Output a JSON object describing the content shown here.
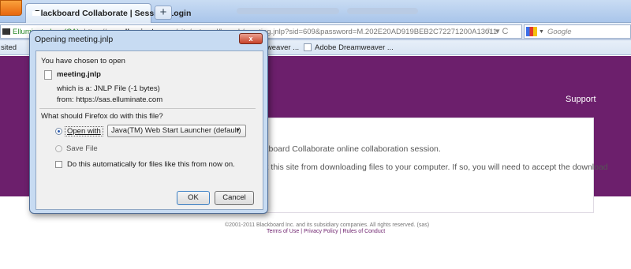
{
  "browser": {
    "tab_title": "Blackboard Collaborate | Session Login",
    "new_tab_glyph": "+",
    "url": {
      "site_identity": "Elluminate Inc. (CA)",
      "scheme": "https://",
      "host": "sas.elluminate.com",
      "rest": "/site/external/launch/meeting.jnlp?sid=609&password=M.202E20AD919BEB2C72271200A13011"
    },
    "search_placeholder": "Google",
    "bookmarks": {
      "partial_left": "sited",
      "item1": "mweaver ...",
      "item2": "Adobe Dreamweaver ..."
    }
  },
  "page": {
    "support_link": "Support",
    "line1": "ckboard Collaborate online collaboration session.",
    "line2": "ck this site from downloading files to your computer. If so, you will need to accept the download",
    "footer_copyright": "©2001-2011 Blackboard Inc. and its subsidiary companies. All rights reserved. (sas)",
    "footer_links": [
      "Terms of Use",
      "Privacy Policy",
      "Rules of Conduct"
    ],
    "footer_separator": "|"
  },
  "dialog": {
    "title": "Opening meeting.jnlp",
    "close_label": "x",
    "intro": "You have chosen to open",
    "file_name": "meeting.jnlp",
    "which_is": "which is a:  JNLP File (-1 bytes)",
    "from": "from:  https://sas.elluminate.com",
    "question": "What should Firefox do with this file?",
    "open_with_label": "Open with",
    "open_with_app": "Java(TM) Web Start Launcher (default)",
    "save_file_label": "Save File",
    "auto_checkbox_label": "Do this automatically for files like this from now on.",
    "ok_label": "OK",
    "cancel_label": "Cancel"
  }
}
